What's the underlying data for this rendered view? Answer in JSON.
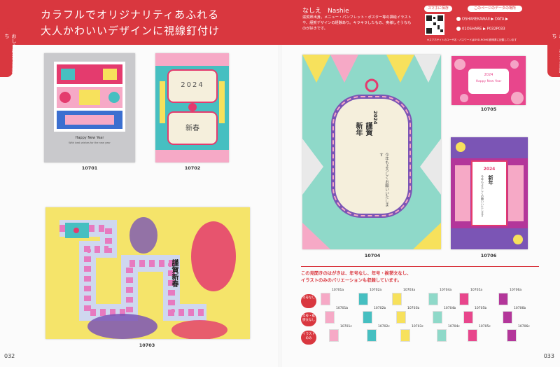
{
  "header": {
    "title_line1": "カラフルでオリジナリティあふれる",
    "title_line2": "大人かわいいデザインに視線釘付け",
    "author": "なしえ　Nashie",
    "author_desc": "滋賀県出身。メニュー・パンフレット・ポスター等の挿絵イラストや、謹賀デザインの経験あり。キラキラしたもの、奥様しそうなものが好きです。",
    "smartphone_label": "スマホに保存",
    "data_place_label": "このページのデータの場所",
    "data_line1": "OSHAREKAWAII ▶ DATA ▶",
    "data_line2": "01OSHARE ▶ P032P033",
    "usage_note": "※スマホサイトのユーザ名・パスワードはDVD-ROMの説明書に記載しています"
  },
  "side_tab": "おしゃれな当日持ち",
  "cards": {
    "c10701": "10701",
    "c10702": "10702",
    "c10703": "10703",
    "c10704": "10704",
    "c10705": "10705",
    "c10706": "10706"
  },
  "card_text": {
    "year": "2024",
    "kinga": "謹賀",
    "shinnen": "新年",
    "shinshun": "新春",
    "kingashinshun": "謹賀新春",
    "happy": "Happy New Year",
    "wishes": "With best wishes for the new year",
    "greeting": "今年もよろしくお願いいたします"
  },
  "variations": {
    "intro_line1": "この見開きのはがきは、年号なし、年号・挨拶文なし、",
    "intro_line2": "イラストのみのバリエーションも収録しています。",
    "badges": [
      "年号なし",
      "年号・挨拶文なし",
      "イラストのみ"
    ],
    "labels": [
      "10701a",
      "10701b",
      "10701c",
      "10702a",
      "10702b",
      "10702c",
      "10703a",
      "10703b",
      "10703c",
      "10704a",
      "10704b",
      "10704c",
      "10705a",
      "10705b",
      "10705c",
      "10706a",
      "10706b",
      "10706c"
    ]
  },
  "page_numbers": {
    "left": "032",
    "right": "033"
  },
  "colors": {
    "accent": "#d9373f",
    "teal": "#46bfc1",
    "pink": "#f07aa8",
    "yellow": "#f7e15c",
    "purple": "#7b55b5"
  }
}
